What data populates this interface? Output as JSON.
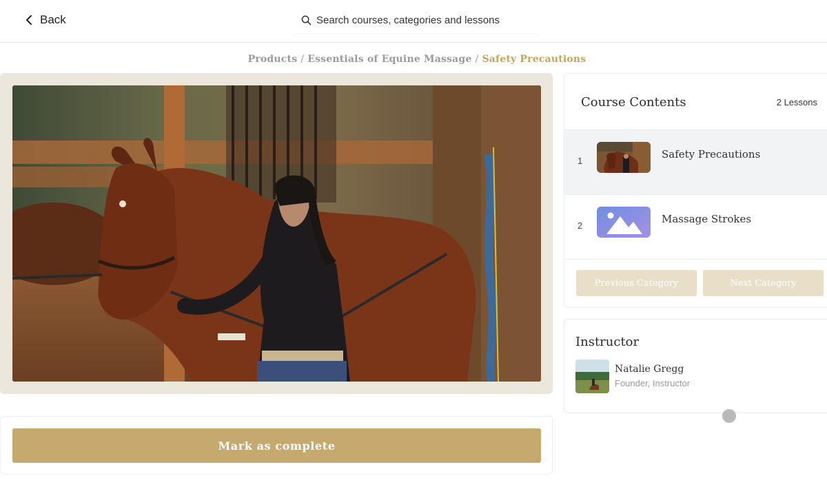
{
  "header": {
    "back_label": "Back",
    "search_placeholder": "Search courses, categories and lessons"
  },
  "breadcrumb": [
    "Products",
    "Essentials of Equine Massage",
    "Safety Precautions"
  ],
  "breadcrumb_separator": "/",
  "main": {
    "complete_button_label": "Mark as complete"
  },
  "course_contents": {
    "title": "Course Contents",
    "lesson_count": "2 Lessons",
    "lessons": [
      {
        "number": "1",
        "title": "Safety Precautions",
        "active": true,
        "thumbnail": "lesson-photo-thumbnail"
      },
      {
        "number": "2",
        "title": "Massage Strokes",
        "active": false,
        "thumbnail": "image-placeholder-icon"
      }
    ],
    "prev_label": "Previous Category",
    "next_label": "Next Category"
  },
  "instructor": {
    "heading": "Instructor",
    "name": "Natalie Gregg",
    "role": "Founder, Instructor"
  },
  "colors": {
    "accent": "#c6a96e",
    "accent_light": "#e9dfc9",
    "breadcrumb_active": "#c4a55d",
    "active_row": "#f2f3f5"
  }
}
